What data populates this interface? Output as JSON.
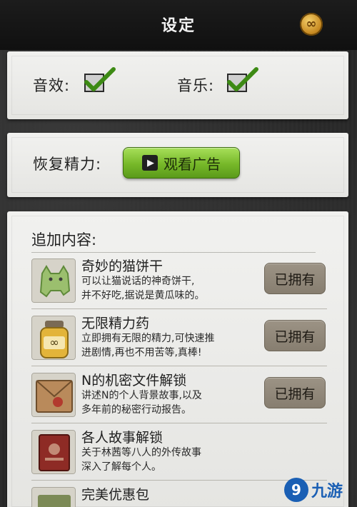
{
  "header": {
    "title": "设定",
    "settings_icon": "token-icon"
  },
  "audio": {
    "sound_label": "音效:",
    "sound_checked": true,
    "music_label": "音乐:",
    "music_checked": true
  },
  "stamina": {
    "label": "恢复精力:",
    "watch_ad_label": "观看广告"
  },
  "extras": {
    "title": "追加内容:",
    "items": [
      {
        "name": "奇妙的猫饼干",
        "desc_line1": "可以让猫说话的神奇饼干,",
        "desc_line2": "并不好吃,据说是黄瓜味的。",
        "button": "已拥有"
      },
      {
        "name": "无限精力药",
        "desc_line1": "立即拥有无限的精力,可快速推",
        "desc_line2": "进剧情,再也不用苦等,真棒!",
        "button": "已拥有"
      },
      {
        "name": "N的机密文件解锁",
        "desc_line1": "讲述N的个人背景故事,以及",
        "desc_line2": "多年前的秘密行动报告。",
        "button": "已拥有"
      },
      {
        "name": "各人故事解锁",
        "desc_line1": "关于林茜等八人的外传故事",
        "desc_line2": "深入了解每个人。",
        "button": ""
      },
      {
        "name": "完美优惠包",
        "desc_line1": "",
        "desc_line2": "",
        "button": ""
      }
    ]
  },
  "watermark": {
    "text": "九游"
  },
  "colors": {
    "accent_green": "#77b829",
    "owned_button": "#8f8678",
    "paper": "#ececea",
    "header": "#151515"
  }
}
